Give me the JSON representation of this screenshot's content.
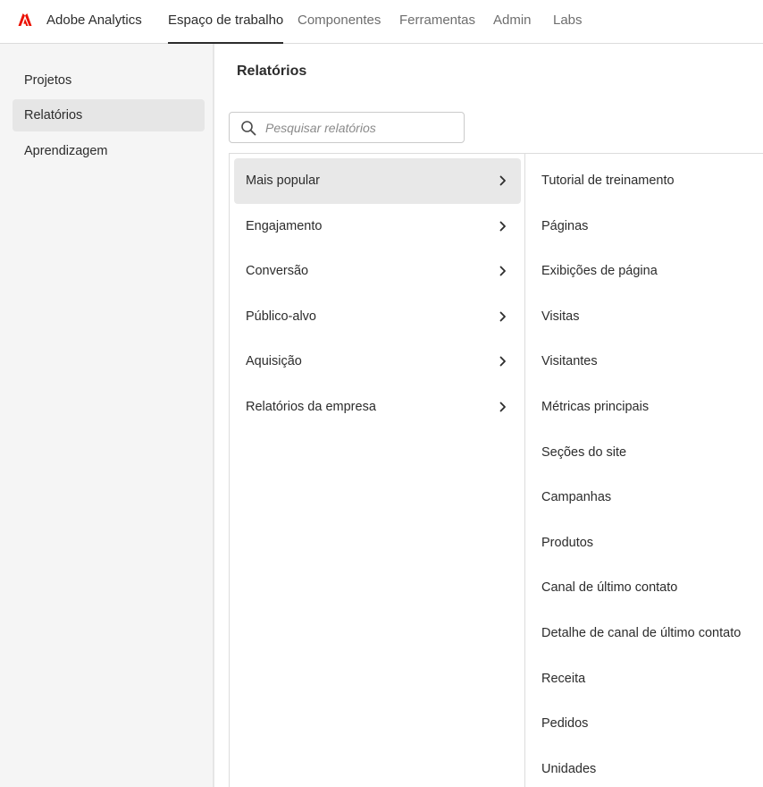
{
  "app": {
    "name": "Adobe Analytics",
    "logo_icon": "adobe-logo-icon",
    "brand_color": "#eb1000"
  },
  "nav": {
    "tabs": [
      {
        "label": "Espaço de trabalho",
        "active": true
      },
      {
        "label": "Componentes"
      },
      {
        "label": "Ferramentas"
      },
      {
        "label": "Admin"
      },
      {
        "label": "Labs"
      }
    ]
  },
  "sidebar": {
    "items": [
      {
        "label": "Projetos"
      },
      {
        "label": "Relatórios",
        "selected": true
      },
      {
        "label": "Aprendizagem"
      }
    ]
  },
  "main": {
    "title": "Relatórios",
    "search": {
      "placeholder": "Pesquisar relatórios",
      "value": "",
      "icon": "search-icon"
    },
    "categories": [
      {
        "label": "Mais popular",
        "selected": true
      },
      {
        "label": "Engajamento"
      },
      {
        "label": "Conversão"
      },
      {
        "label": "Público-alvo"
      },
      {
        "label": "Aquisição"
      },
      {
        "label": "Relatórios da empresa"
      }
    ],
    "reports": [
      "Tutorial de treinamento",
      "Páginas",
      "Exibições de página",
      "Visitas",
      "Visitantes",
      "Métricas principais",
      "Seções do site",
      "Campanhas",
      "Produtos",
      "Canal de último contato",
      "Detalhe de canal de último contato",
      "Receita",
      "Pedidos",
      "Unidades"
    ]
  }
}
